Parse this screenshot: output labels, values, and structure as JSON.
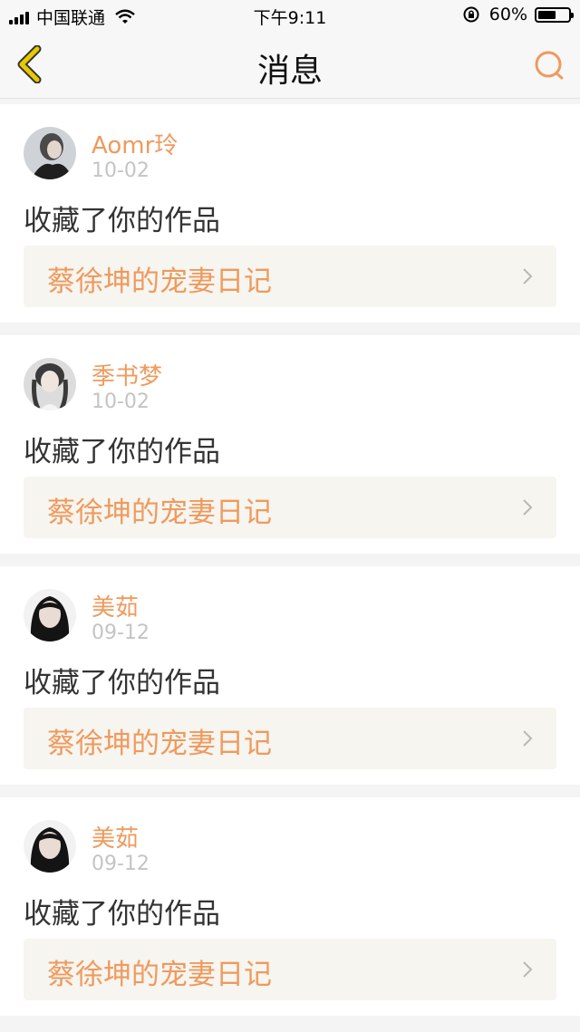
{
  "status_bar": {
    "carrier": "中国联通",
    "time": "下午9:11",
    "battery_percent_text": "60%",
    "battery_level": 0.6
  },
  "nav": {
    "title": "消息",
    "back_icon": "chevron-left-icon",
    "search_icon": "search-icon"
  },
  "colors": {
    "accent": "#ef9a5d",
    "back_icon": "#d4b000"
  },
  "messages": [
    {
      "user": "Aomr玲",
      "date": "10-02",
      "action": "收藏了你的作品",
      "work": "蔡徐坤的宠妻日记"
    },
    {
      "user": "季书梦",
      "date": "10-02",
      "action": "收藏了你的作品",
      "work": "蔡徐坤的宠妻日记"
    },
    {
      "user": "美茹",
      "date": "09-12",
      "action": "收藏了你的作品",
      "work": "蔡徐坤的宠妻日记"
    },
    {
      "user": "美茹",
      "date": "09-12",
      "action": "收藏了你的作品",
      "work": "蔡徐坤的宠妻日记"
    }
  ]
}
